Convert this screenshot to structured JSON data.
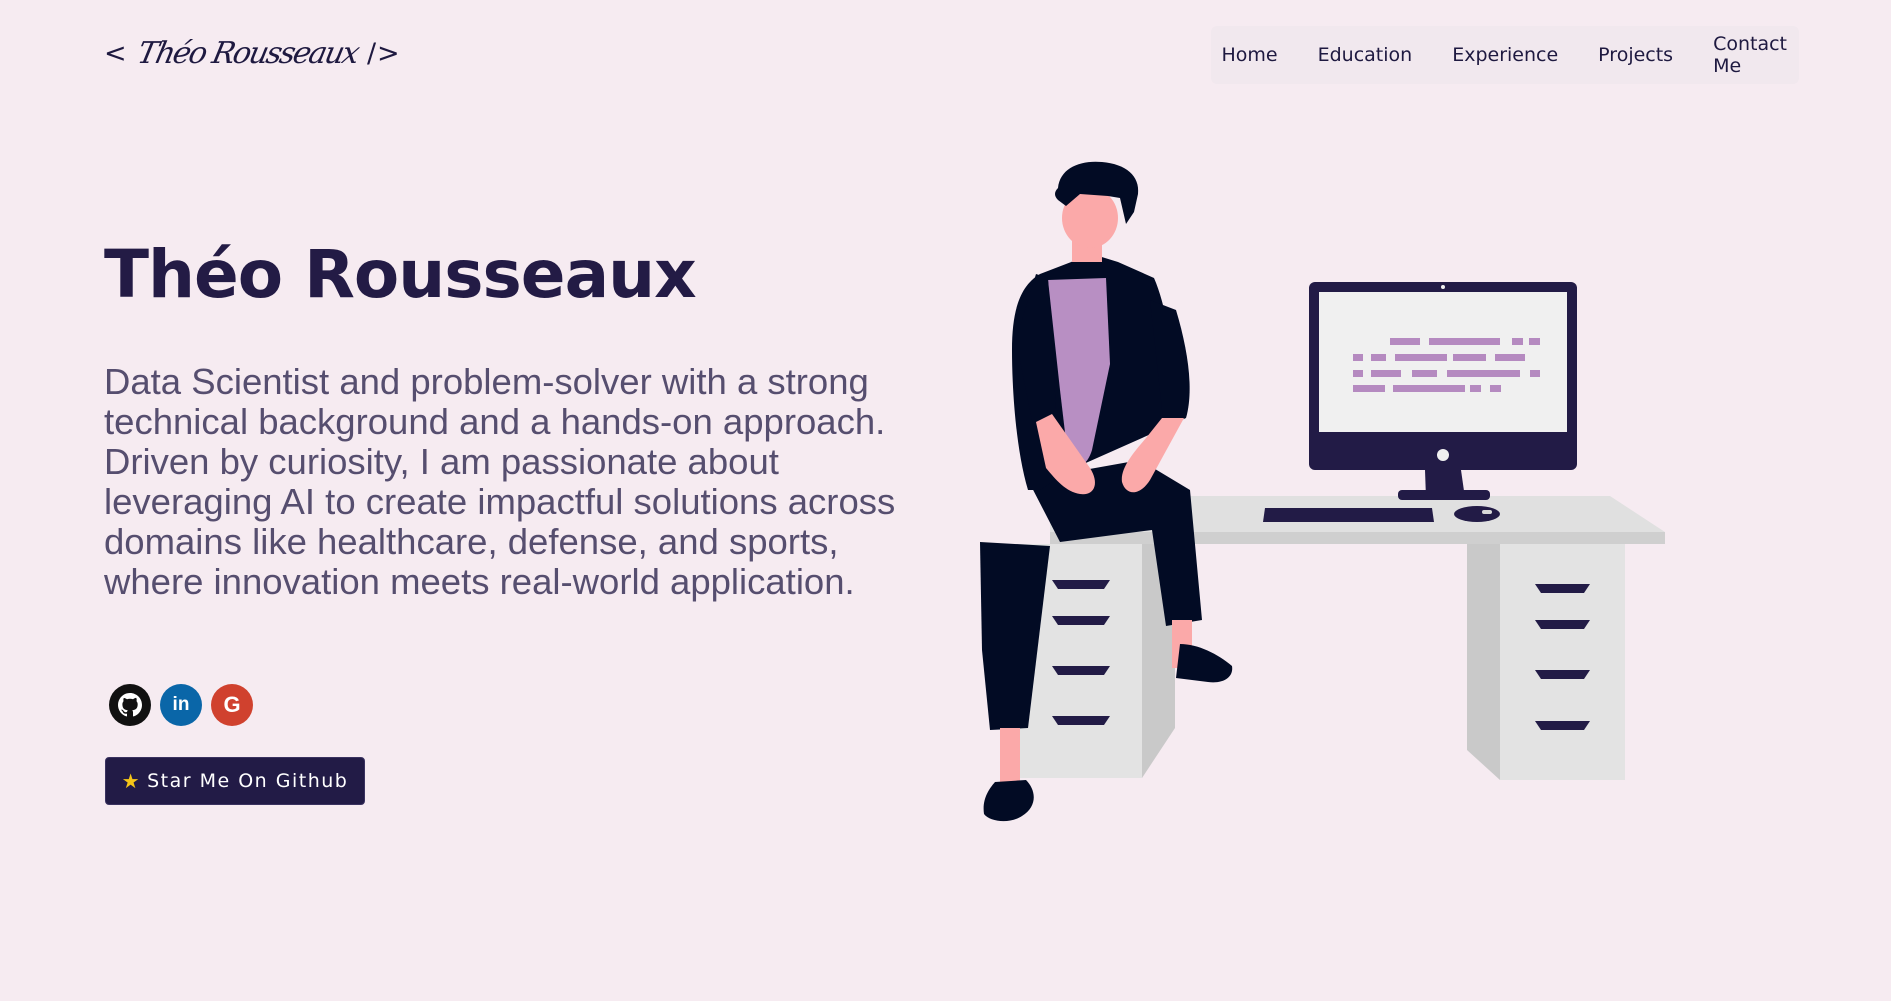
{
  "header": {
    "logo": {
      "open": "<",
      "signature": "Théo Rousseaux",
      "close": "/>"
    },
    "nav": [
      "Home",
      "Education",
      "Experience",
      "Projects",
      "Contact Me"
    ]
  },
  "hero": {
    "name": "Théo Rousseaux",
    "bio": "Data Scientist and problem-solver with a strong technical background and a hands-on approach. Driven by curiosity, I am passionate about leveraging AI to create impactful solutions across domains like healthcare, defense, and sports, where innovation meets real-world application.",
    "socials": [
      {
        "name": "github",
        "icon": "github-icon",
        "color": "#111111"
      },
      {
        "name": "linkedin",
        "icon": "linkedin-icon",
        "glyph": "in",
        "color": "#0a66a8"
      },
      {
        "name": "google",
        "icon": "google-icon",
        "glyph": "G",
        "color": "#d0412e"
      }
    ],
    "cta": {
      "icon": "star-icon",
      "label": "Star Me On Github"
    }
  },
  "colors": {
    "background": "#f6ebf1",
    "primary": "#221b46",
    "text_muted": "#564e6f",
    "accent_purple": "#b58ac0"
  }
}
